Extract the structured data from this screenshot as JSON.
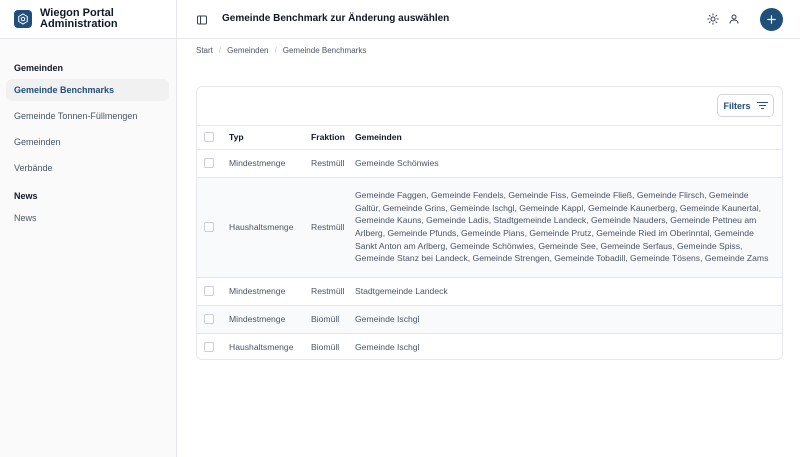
{
  "app": {
    "name_line1": "Wiegon Portal",
    "name_line2": "Administration"
  },
  "sidebar": {
    "groups": [
      {
        "title": "Gemeinden",
        "items": [
          {
            "label": "Gemeinde Benchmarks",
            "active": true
          },
          {
            "label": "Gemeinde Tonnen-Füllmengen"
          },
          {
            "label": "Gemeinden"
          },
          {
            "label": "Verbände"
          }
        ]
      },
      {
        "title": "News",
        "items": [
          {
            "label": "News"
          }
        ]
      }
    ]
  },
  "header": {
    "title": "Gemeinde Benchmark zur Änderung auswählen"
  },
  "breadcrumb": [
    "Start",
    "Gemeinden",
    "Gemeinde Benchmarks"
  ],
  "toolbar": {
    "filter_label": "Filters"
  },
  "table": {
    "columns": [
      "Typ",
      "Fraktion",
      "Gemeinden"
    ],
    "rows": [
      {
        "typ": "Mindestmenge",
        "fraktion": "Restmüll",
        "gemeinden": "Gemeinde Schönwies"
      },
      {
        "typ": "Haushaltsmenge",
        "fraktion": "Restmüll",
        "gemeinden": "Gemeinde Faggen, Gemeinde Fendels, Gemeinde Fiss, Gemeinde Fließ, Gemeinde Flirsch, Gemeinde Galtür, Gemeinde Grins, Gemeinde Ischgl, Gemeinde Kappl, Gemeinde Kaunerberg, Gemeinde Kaunertal, Gemeinde Kauns, Gemeinde Ladis, Stadtgemeinde Landeck, Gemeinde Nauders, Gemeinde Pettneu am Arlberg, Gemeinde Pfunds, Gemeinde Pians, Gemeinde Prutz, Gemeinde Ried im Oberinntal, Gemeinde Sankt Anton am Arlberg, Gemeinde Schönwies, Gemeinde See, Gemeinde Serfaus, Gemeinde Spiss, Gemeinde Stanz bei Landeck, Gemeinde Strengen, Gemeinde Tobadill, Gemeinde Tösens, Gemeinde Zams"
      },
      {
        "typ": "Mindestmenge",
        "fraktion": "Restmüll",
        "gemeinden": "Stadtgemeinde Landeck"
      },
      {
        "typ": "Mindestmenge",
        "fraktion": "Biomüll",
        "gemeinden": "Gemeinde Ischgl"
      },
      {
        "typ": "Haushaltsmenge",
        "fraktion": "Biomüll",
        "gemeinden": "Gemeinde Ischgl"
      }
    ]
  },
  "icons": {
    "logo": "hexagon-gear-icon",
    "sidebar_toggle": "sidebar-panel-icon",
    "theme": "sun-icon",
    "user": "user-icon",
    "add": "plus-icon",
    "filter": "filter-lines-icon"
  },
  "colors": {
    "brand": "#1f4f7a",
    "border": "#e5e7eb",
    "row_alt": "#f9fafb"
  }
}
